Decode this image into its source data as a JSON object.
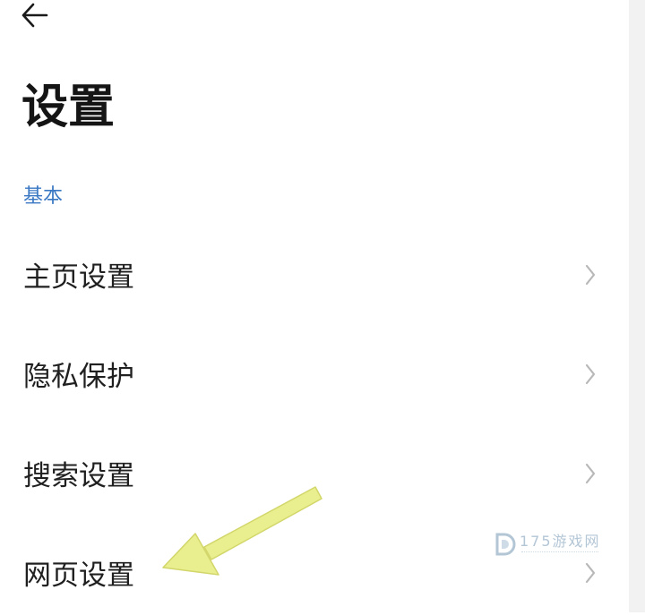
{
  "header": {
    "back_icon": "arrow-left-icon",
    "title": "设置"
  },
  "section": {
    "label": "基本"
  },
  "menu": {
    "items": [
      {
        "label": "主页设置",
        "icon": "chevron-right-icon"
      },
      {
        "label": "隐私保护",
        "icon": "chevron-right-icon"
      },
      {
        "label": "搜索设置",
        "icon": "chevron-right-icon"
      },
      {
        "label": "网页设置",
        "icon": "chevron-right-icon"
      }
    ]
  },
  "annotation": {
    "icon": "yellow-pointer-arrow",
    "color": "#e9ef8e"
  },
  "watermark": {
    "text": "175游戏网",
    "icon": "d-logo-icon"
  },
  "colors": {
    "background": "#ffffff",
    "title": "#151515",
    "section_label": "#3a78c3",
    "item_text": "#202020",
    "chevron": "#b8b8b8"
  }
}
